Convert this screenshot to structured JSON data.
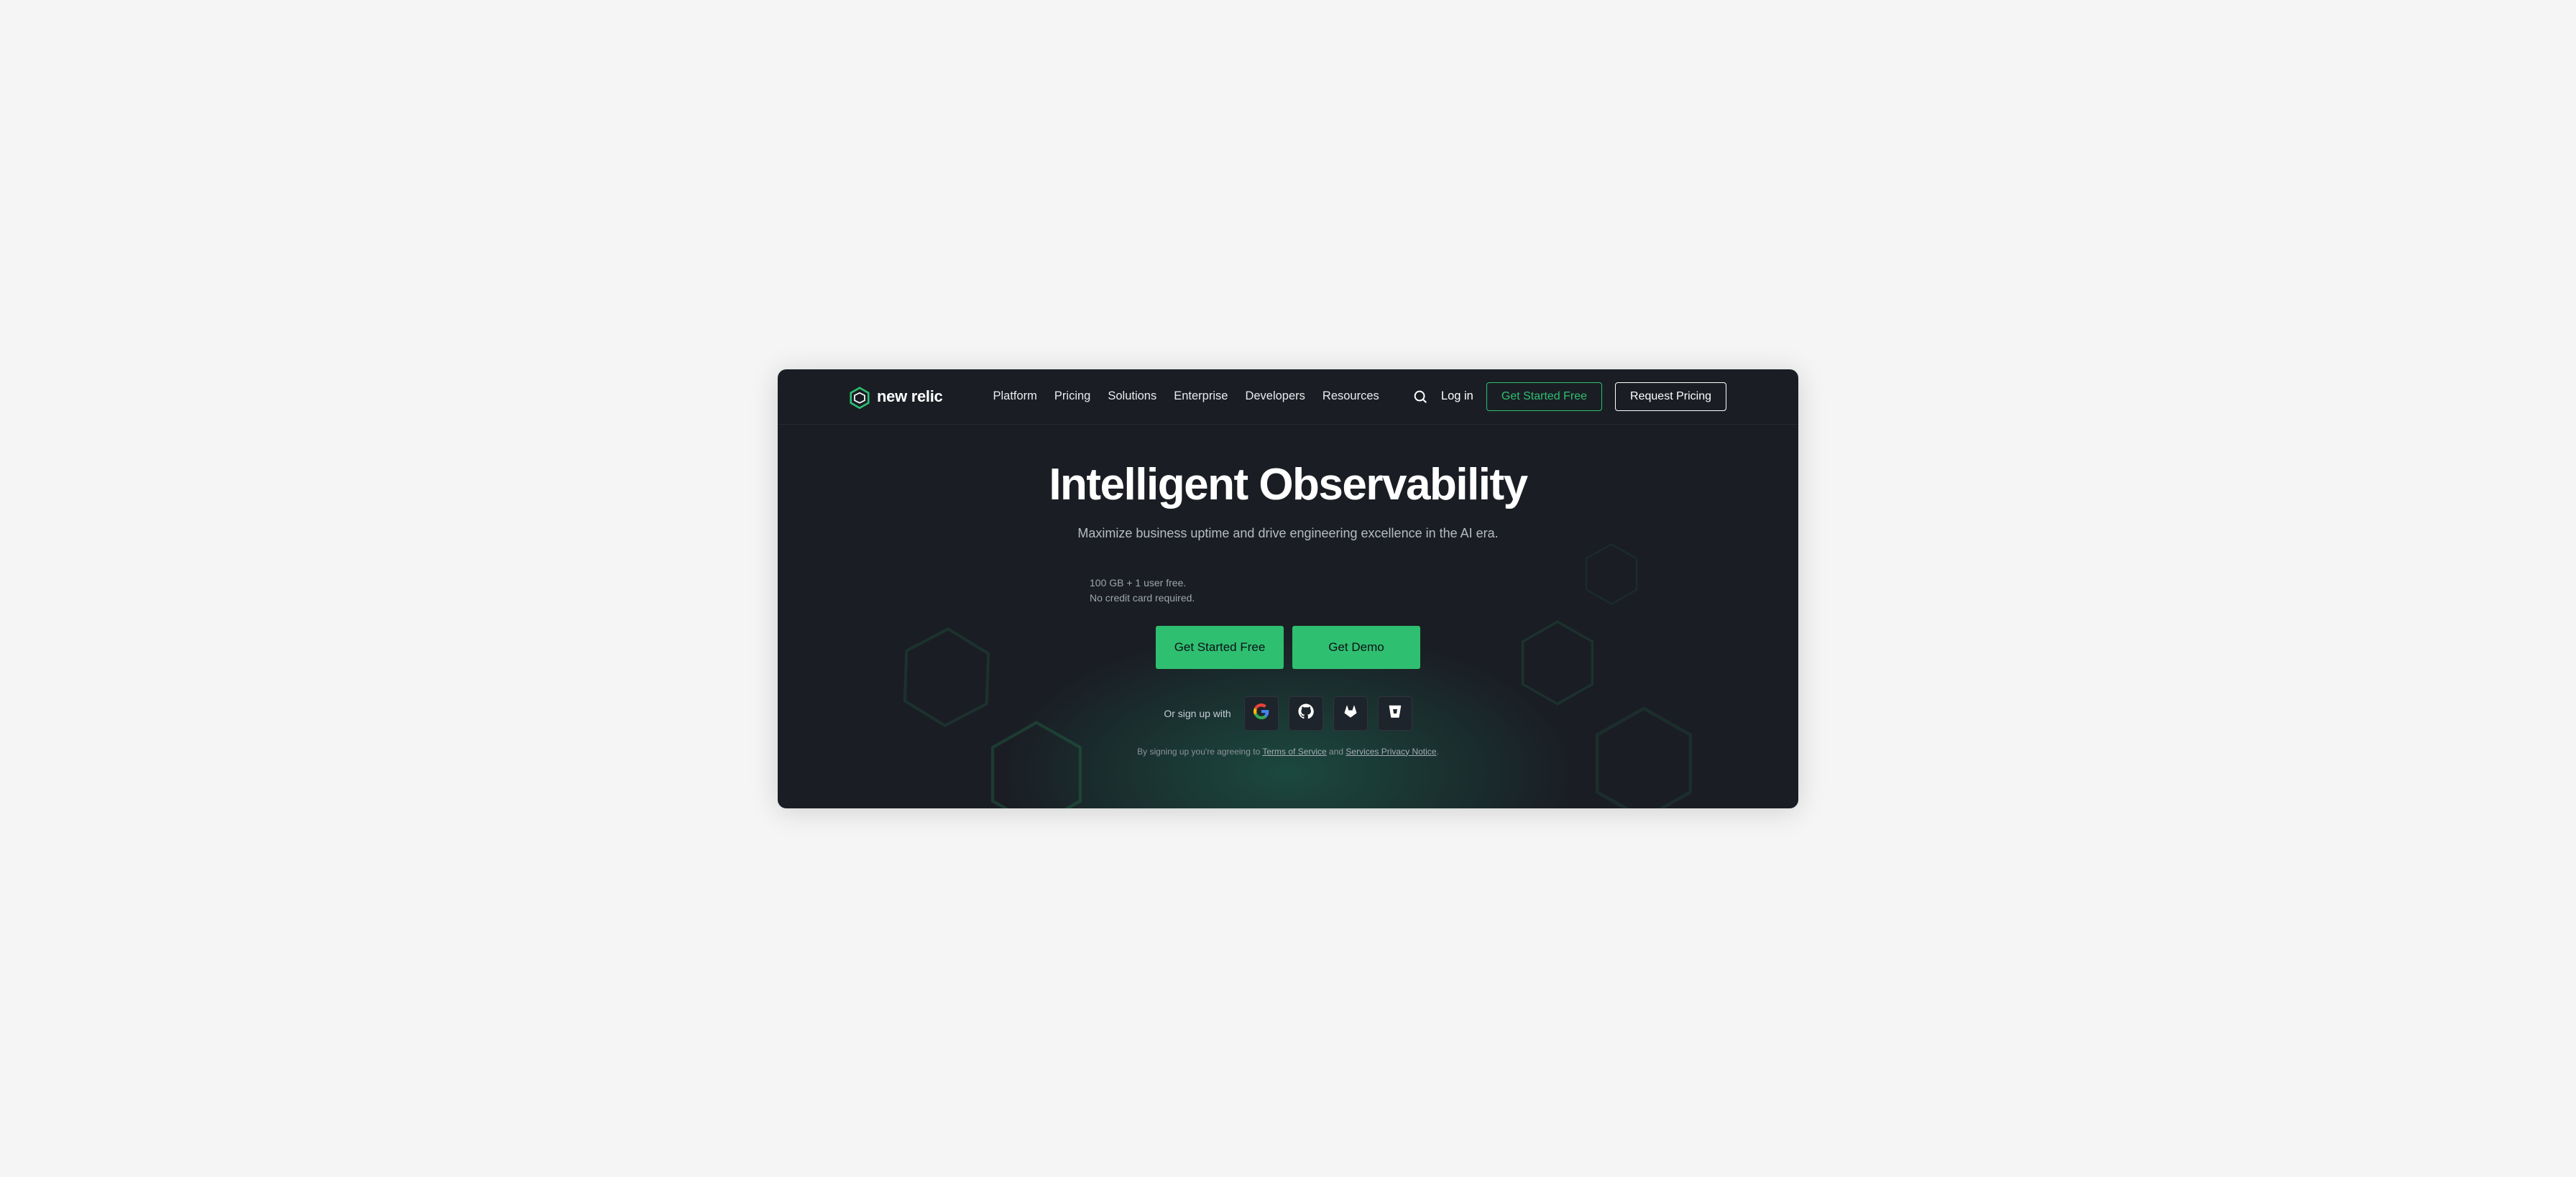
{
  "brand": {
    "name": "new relic"
  },
  "nav": {
    "items": [
      "Platform",
      "Pricing",
      "Solutions",
      "Enterprise",
      "Developers",
      "Resources"
    ]
  },
  "header_actions": {
    "login": "Log in",
    "get_started": "Get Started Free",
    "request_pricing": "Request Pricing"
  },
  "hero": {
    "title": "Intelligent Observability",
    "subtitle": "Maximize business uptime and drive engineering excellence in the AI era.",
    "offer_line1": "100 GB + 1 user free.",
    "offer_line2": "No credit card required.",
    "cta_primary": "Get Started Free",
    "cta_secondary": "Get Demo",
    "signup_with": "Or sign up with",
    "legal_prefix": "By signing up you're agreeing to ",
    "legal_tos": "Terms of Service",
    "legal_mid": " and ",
    "legal_privacy": "Services Privacy Notice",
    "legal_suffix": "."
  },
  "social": {
    "providers": [
      "google",
      "github",
      "gitlab",
      "bitbucket"
    ]
  },
  "colors": {
    "bg": "#1a1e24",
    "accent": "#2fbf71"
  }
}
